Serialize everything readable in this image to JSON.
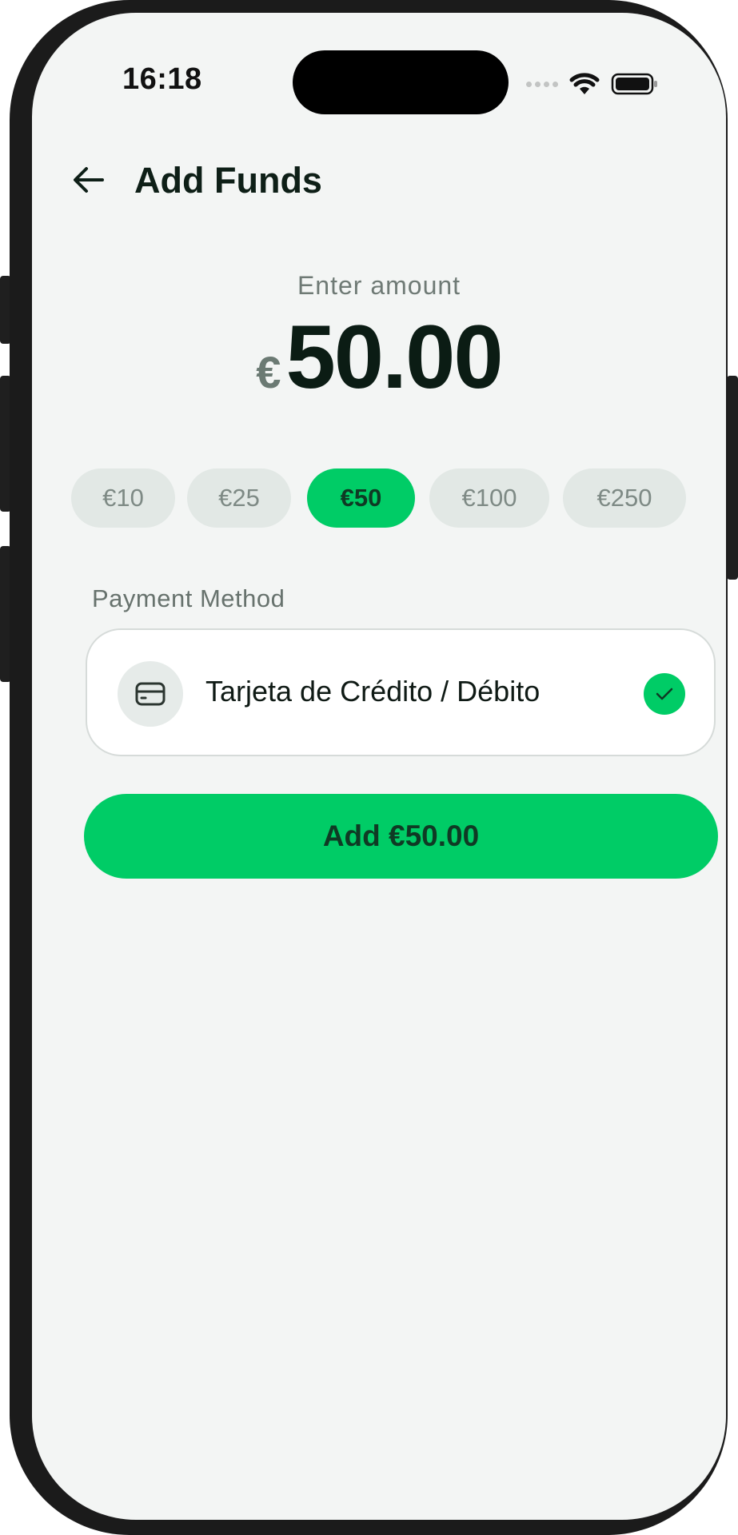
{
  "status_bar": {
    "time": "16:18",
    "icons": [
      "signal-dots-icon",
      "wifi-icon",
      "battery-icon"
    ]
  },
  "header": {
    "back_icon": "arrow-left-icon",
    "title": "Add Funds"
  },
  "amount": {
    "label": "Enter amount",
    "currency_symbol": "€",
    "value": "50.00"
  },
  "quick_amounts": [
    {
      "label": "€10",
      "selected": false
    },
    {
      "label": "€25",
      "selected": false
    },
    {
      "label": "€50",
      "selected": true
    },
    {
      "label": "€100",
      "selected": false
    },
    {
      "label": "€250",
      "selected": false
    }
  ],
  "payment_method": {
    "label": "Payment Method",
    "option": {
      "icon": "credit-card-icon",
      "name": "Tarjeta de Crédito / Débito",
      "selected": true
    }
  },
  "submit": {
    "label": "Add €50.00"
  },
  "colors": {
    "accent": "#00cc66",
    "background": "#f3f5f4",
    "chip_inactive": "#e2e8e5",
    "text_dark": "#0b1c14"
  }
}
